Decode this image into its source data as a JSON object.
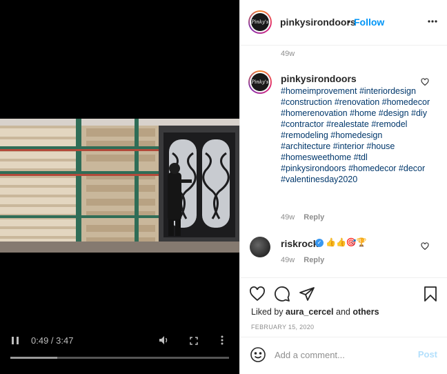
{
  "account": {
    "username": "pinkysirondoors",
    "follow_label": "Follow",
    "separator": "•"
  },
  "video": {
    "time_display": "0:49 / 3:47",
    "progress": 0.216
  },
  "comments": {
    "top_age": "49w",
    "caption": {
      "username": "pinkysirondoors",
      "text": "#homeimprovement #interiordesign #construction #renovation #homedecor #homerenovation #home #design #diy #contractor #realestate #remodel #remodeling #homedesign #architecture #interior #house #homesweethome #tdl #pinkysirondoors #homedecor #decor #valentinesday2020",
      "age": "49w",
      "reply_label": "Reply"
    },
    "items": [
      {
        "username": "riskrock",
        "text": "👍👍🎯🏆",
        "age": "49w",
        "reply_label": "Reply"
      }
    ]
  },
  "engagement": {
    "liked_by_prefix": "Liked by ",
    "liked_by_user": "aura_cercel",
    "liked_by_suffix": " and ",
    "liked_by_others": "others",
    "date": "FEBRUARY 15, 2020"
  },
  "add_comment": {
    "placeholder": "Add a comment...",
    "post_label": "Post"
  },
  "icons": [
    "pause-icon",
    "volume-icon",
    "fullscreen-icon",
    "more-vertical-icon",
    "more-horizontal-icon",
    "heart-icon",
    "comment-icon",
    "share-icon",
    "bookmark-icon",
    "emoji-icon",
    "verified-icon"
  ],
  "colors": {
    "accent": "#0095f6",
    "hashtag": "#00376b",
    "muted": "#8e8e8e",
    "post_disabled": "#b2dffc",
    "verified": "#3897f0"
  }
}
